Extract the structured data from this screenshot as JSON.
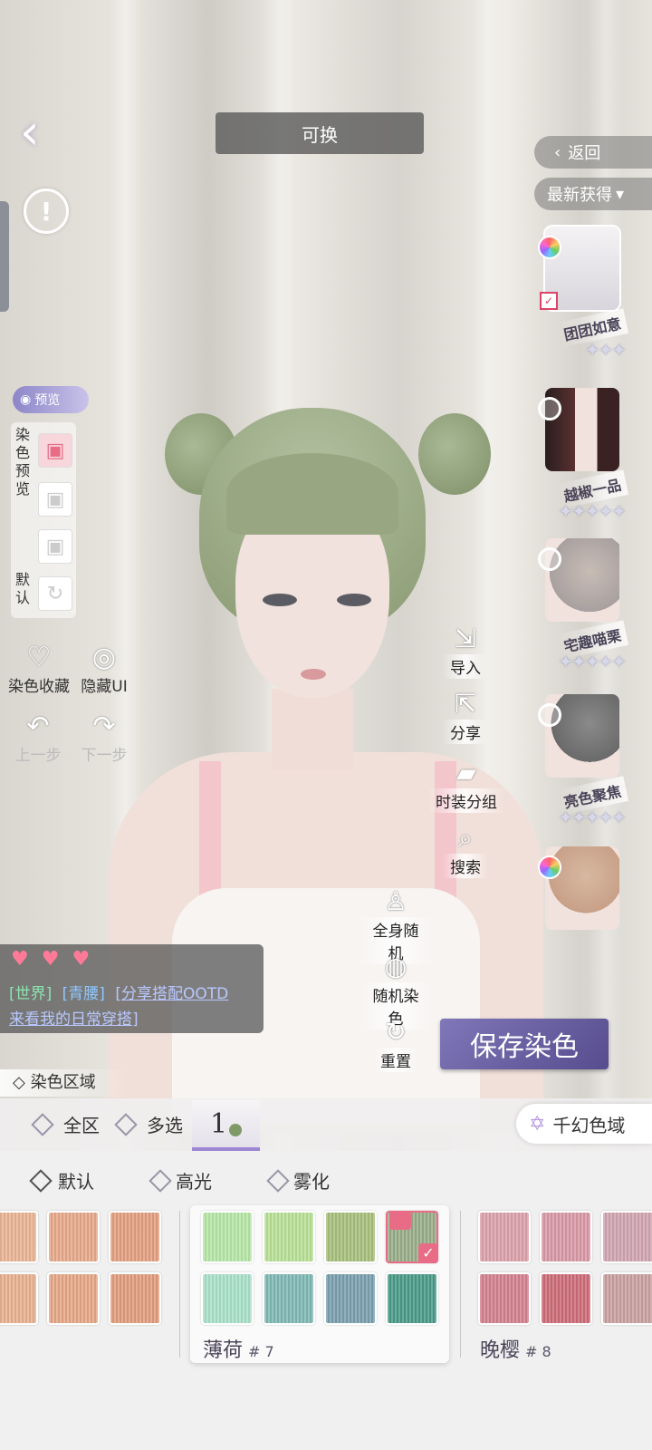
{
  "header": {
    "title": "可换"
  },
  "nav": {
    "return_label": "返回",
    "sort_label": "最新获得"
  },
  "items": [
    {
      "name": "团团如意",
      "stars": 3,
      "selected": true,
      "indicator": "color"
    },
    {
      "name": "越椒一品",
      "stars": 5,
      "selected": false,
      "indicator": "ring"
    },
    {
      "name": "宅趣喵栗",
      "stars": 5,
      "selected": false,
      "indicator": "ring"
    },
    {
      "name": "亮色聚焦",
      "stars": 5,
      "selected": false,
      "indicator": "ring"
    },
    {
      "name": "",
      "stars": 0,
      "selected": false,
      "indicator": "color"
    }
  ],
  "star_glyphs": {
    "three": "✦✦✦",
    "five": "✦✦✦✦✦"
  },
  "preview": {
    "badge": "预览",
    "label": "染色预览",
    "default_label": "默认"
  },
  "tools_left": {
    "favorite": "染色收藏",
    "hide_ui": "隐藏UI",
    "undo": "上一步",
    "redo": "下一步"
  },
  "tools_right": {
    "import": "导入",
    "share": "分享",
    "group": "时装分组",
    "search": "搜索",
    "random_body": "全身随机",
    "random_dye": "随机染色",
    "reset": "重置"
  },
  "chat": {
    "channel": "[世界]",
    "user": "[青腰]",
    "message_1": "[分享搭配OOTD",
    "message_2": "来看我的日常穿搭]"
  },
  "save_button": "保存染色",
  "dye_region": {
    "title": "染色区域",
    "tabs": [
      "全区",
      "多选"
    ],
    "active_tab": "1",
    "fantasy_label": "千幻色域"
  },
  "filters": [
    "默认",
    "高光",
    "雾化"
  ],
  "color_groups": [
    {
      "name": "薄荷",
      "number": "# 7"
    },
    {
      "name": "晚樱",
      "number": "# 8"
    }
  ],
  "colors": {
    "peach": [
      "#e9b394",
      "#e6a98a",
      "#e29f80",
      "#e8b090",
      "#e5a686",
      "#e09c7c"
    ],
    "mint": [
      "#b6e6a6",
      "#b8df96",
      "#a7bf7c",
      "#98ad88",
      "#a8e0c8",
      "#7fb8b4",
      "#7a9fae",
      "#4a9a88"
    ],
    "sakura": [
      "#dba0aa",
      "#d899a6",
      "#d0a4b0",
      "#d2808e",
      "#cc6c78",
      "#c9a0a0"
    ],
    "accent": "#7f77b8"
  }
}
